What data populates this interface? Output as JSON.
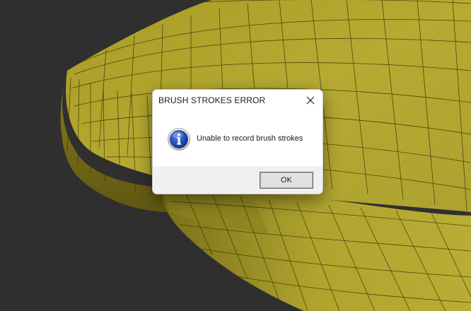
{
  "dialog": {
    "title": "BRUSH STROKES ERROR",
    "message": "Unable to record brush strokes",
    "icon": "info-icon",
    "ok_label": "OK",
    "close_icon": "close-icon"
  },
  "viewport": {
    "background_color": "#2f2f2f",
    "mesh_color": "#b3a62e"
  }
}
